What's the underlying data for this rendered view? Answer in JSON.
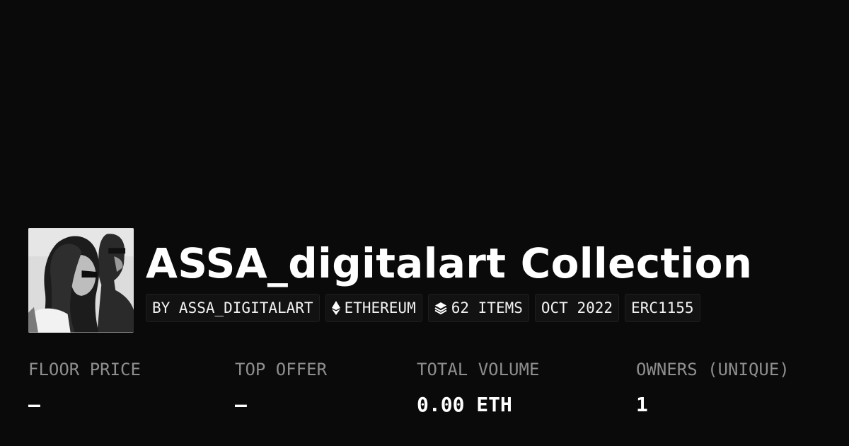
{
  "collection": {
    "title": "ASSA_digitalart Collection",
    "avatar_icon": "collection-avatar-portrait"
  },
  "badges": {
    "creator": "BY ASSA_DIGITALART",
    "chain": "ETHEREUM",
    "chain_icon": "ethereum-icon",
    "items": "62 ITEMS",
    "items_icon": "layers-icon",
    "date": "OCT 2022",
    "standard": "ERC1155"
  },
  "stats": {
    "floor_price": {
      "label": "FLOOR PRICE",
      "value": "–"
    },
    "top_offer": {
      "label": "TOP OFFER",
      "value": "–"
    },
    "total_volume": {
      "label": "TOTAL VOLUME",
      "value": "0.00 ETH"
    },
    "owners": {
      "label": "OWNERS (UNIQUE)",
      "value": "1"
    }
  },
  "colors": {
    "background": "#0a0a0a",
    "text": "#ffffff",
    "muted_label": "#8e8e8e",
    "pill_background": "#121212"
  }
}
